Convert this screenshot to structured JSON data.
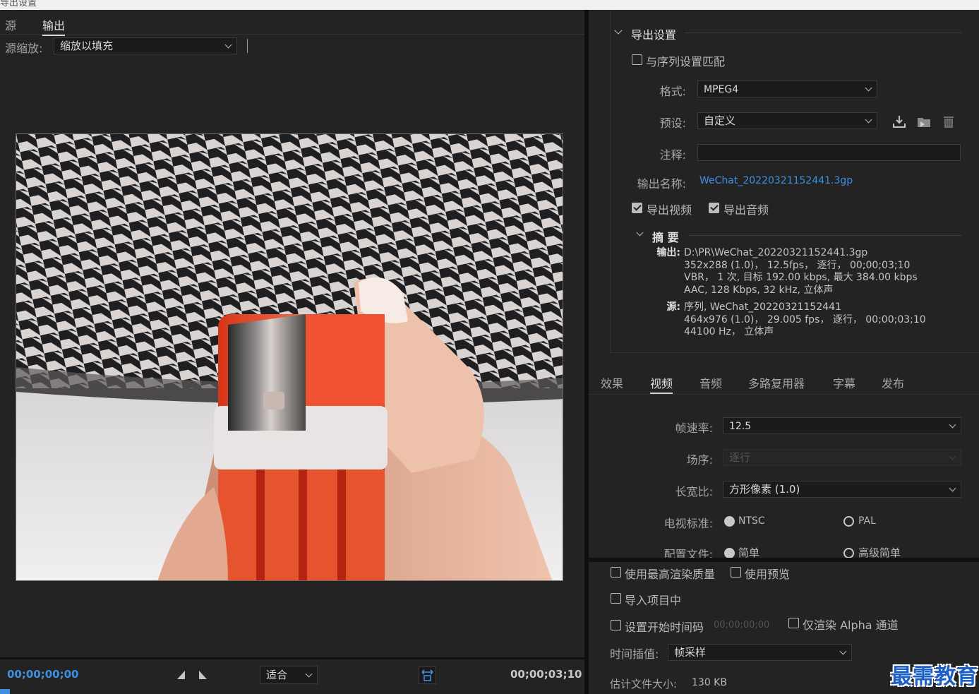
{
  "window": {
    "title": "导出设置"
  },
  "source_panel": {
    "tabs": [
      {
        "label": "源"
      },
      {
        "label": "输出"
      }
    ],
    "scale_label": "源缩放:",
    "scale_value": "缩放以填充"
  },
  "playback": {
    "current_time": "00;00;00;00",
    "end_time": "00;00;03;10",
    "fit_value": "适合"
  },
  "export_settings": {
    "section_title": "导出设置",
    "match_sequence": "与序列设置匹配",
    "format_label": "格式:",
    "format_value": "MPEG4",
    "preset_label": "预设:",
    "preset_value": "自定义",
    "comment_label": "注释:",
    "comment_value": "",
    "output_name_label": "输出名称:",
    "output_name_value": "WeChat_20220321152441.3gp",
    "export_video": "导出视频",
    "export_audio": "导出音频"
  },
  "summary": {
    "title": "摘 要",
    "output_label": "输出:",
    "output_lines": [
      "D:\\PR\\WeChat_20220321152441.3gp",
      "352x288 (1.0)，  12.5fps，  逐行，   00;00;03;10",
      "VBR，  1 次, 目标 192.00 kbps, 最大 384.00 kbps",
      "AAC, 128 Kbps, 32  kHz, 立体声"
    ],
    "source_label": "源:",
    "source_lines": [
      "序列, WeChat_20220321152441",
      "464x976 (1.0)，  29.005 fps，  逐行，   00;00;03;10",
      "44100 Hz，  立体声"
    ]
  },
  "settings_tabs": [
    {
      "label": "效果"
    },
    {
      "label": "视频"
    },
    {
      "label": "音频"
    },
    {
      "label": "多路复用器"
    },
    {
      "label": "字幕"
    },
    {
      "label": "发布"
    }
  ],
  "video": {
    "framerate_label": "帧速率:",
    "framerate_value": "12.5",
    "field_label": "场序:",
    "field_value": "逐行",
    "aspect_label": "长宽比:",
    "aspect_value": "方形像素 (1.0)",
    "tv_label": "电视标准:",
    "tv_ntsc": "NTSC",
    "tv_pal": "PAL",
    "profile_label": "配置文件:",
    "profile_simple": "简单",
    "profile_advanced": "高级简单"
  },
  "bottom": {
    "max_render": "使用最高渲染质量",
    "use_preview": "使用预览",
    "import_project": "导入项目中",
    "set_start_tc": "设置开始时间码",
    "start_tc_value": "00;00;00;00",
    "alpha_only": "仅渲染 Alpha 通道",
    "interp_label": "时间插值:",
    "interp_value": "帧采样",
    "filesize_label": "估计文件大小:",
    "filesize_value": "130 KB"
  },
  "watermark": "最需教育",
  "colors": {
    "accent": "#3e8fdf",
    "panel": "#232323",
    "field": "#1b1b1b"
  }
}
